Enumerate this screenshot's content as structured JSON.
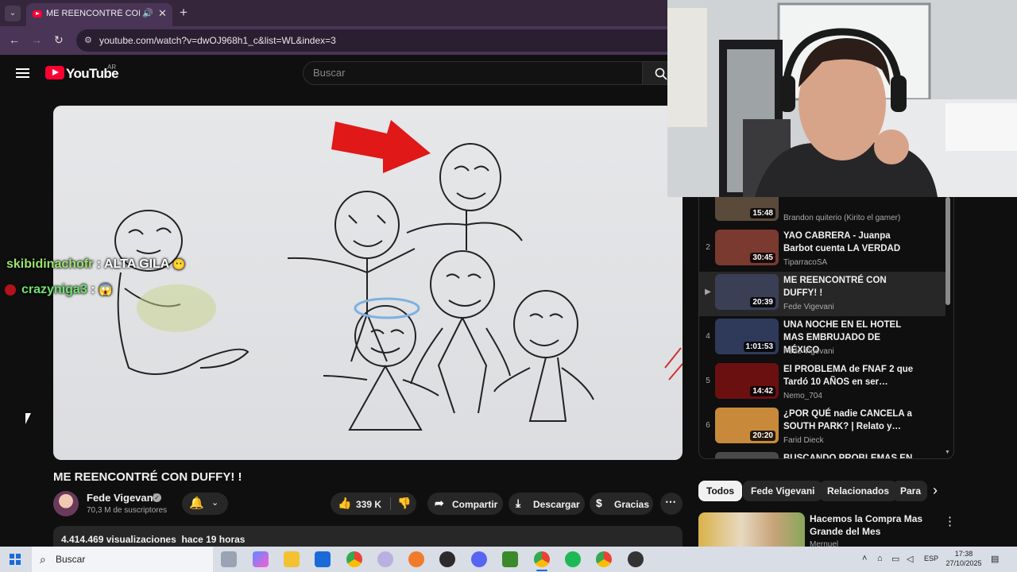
{
  "browser": {
    "tab_title": "ME REENCONTRÉ CON DUFFY! !",
    "tab_audio_icon": "speaker-icon",
    "new_tab_label": "+",
    "url": "youtube.com/watch?v=dwOJ968h1_c&list=WL&index=3"
  },
  "header": {
    "wordmark": "YouTube",
    "country": "AR",
    "search_placeholder": "Buscar"
  },
  "chat_overlay": {
    "line1_user": "skibidinachofr",
    "line1_msg": " : ALTA GILA",
    "line2_user": "crazyniga3",
    "line2_msg": " :"
  },
  "video": {
    "title": "ME REENCONTRÉ CON DUFFY! !",
    "channel": "Fede Vigevani",
    "subscribers": "70,3 M de suscriptores",
    "likes": "339 K",
    "share": "Compartir",
    "download": "Descargar",
    "thanks": "Gracias",
    "views": "4.414.469 visualizaciones",
    "age": "hace 19 horas"
  },
  "playlist": {
    "items": [
      {
        "index": "",
        "duration": "15:48",
        "title": "",
        "channel": "Brandon quiterio (Kirito el gamer)",
        "thumb": "#5a4a3a"
      },
      {
        "index": "2",
        "duration": "30:45",
        "title": "YAO CABRERA - Juanpa Barbot cuenta LA VERDAD",
        "channel": "TiparracoSA",
        "thumb": "#7a3a30"
      },
      {
        "index": "▶",
        "duration": "20:39",
        "title": "ME REENCONTRÉ CON DUFFY! !",
        "channel": "Fede Vigevani",
        "thumb": "#3a3f55"
      },
      {
        "index": "4",
        "duration": "1:01:53",
        "title": "UNA NOCHE EN EL HOTEL MAS EMBRUJADO DE MÉXICO",
        "channel": "Fede Vigevani",
        "thumb": "#2f3a5a"
      },
      {
        "index": "5",
        "duration": "14:42",
        "title": "El PROBLEMA de FNAF 2 que Tardó 10 AÑOS en ser…",
        "channel": "Nemo_704",
        "thumb": "#6a1010"
      },
      {
        "index": "6",
        "duration": "20:20",
        "title": "¿POR QUÉ nadie CANCELA a SOUTH PARK? | Relato y…",
        "channel": "Farid Dieck",
        "thumb": "#c88a3a"
      },
      {
        "index": "",
        "duration": "",
        "title": "BUSCANDO PROBLEMAS EN CONSTITUCIÓN",
        "channel": "",
        "thumb": "#4a4a4a"
      }
    ]
  },
  "chips": [
    "Todos",
    "Fede Vigevani",
    "Relacionados",
    "Para"
  ],
  "recommendation": {
    "title": "Hacemos la Compra Mas Grande del Mes",
    "channel": "Mernuel"
  },
  "taskbar": {
    "search_label": "Buscar",
    "language": "ESP",
    "time": "17:38",
    "date": "27/10/2025"
  }
}
